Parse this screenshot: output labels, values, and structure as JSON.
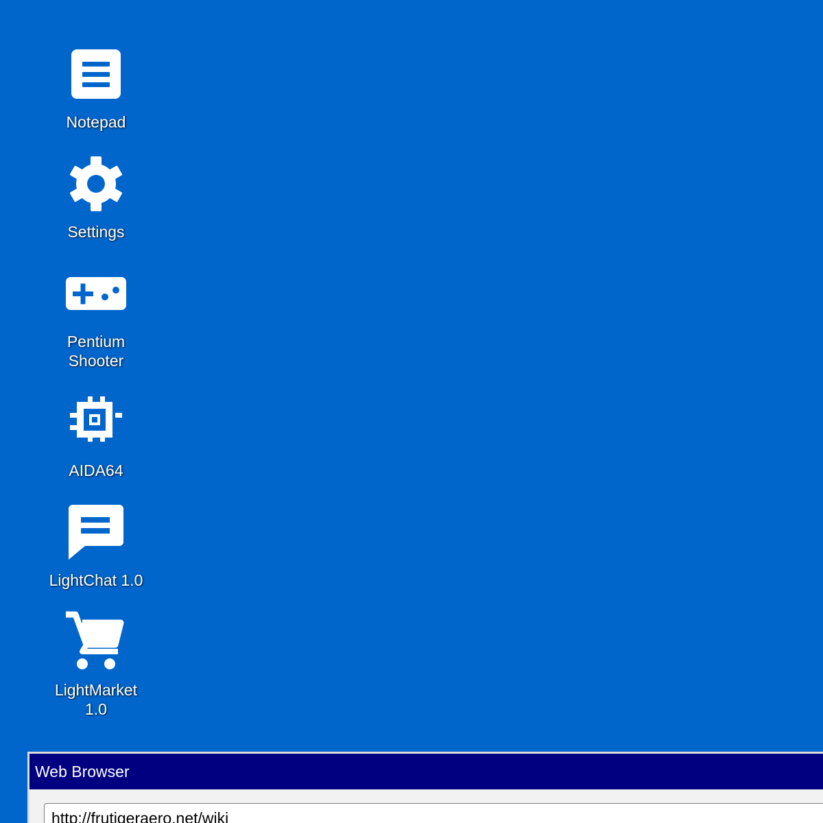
{
  "desktop": {
    "background_color": "#0066cc",
    "icons": [
      {
        "label": "Notepad",
        "icon": "notepad-icon"
      },
      {
        "label": "Settings",
        "icon": "gear-icon"
      },
      {
        "label": "Pentium\nShooter",
        "icon": "gamepad-icon"
      },
      {
        "label": "AIDA64",
        "icon": "chip-icon"
      },
      {
        "label": "LightChat 1.0",
        "icon": "chat-bubble-icon"
      },
      {
        "label": "LightMarket\n1.0",
        "icon": "shopping-cart-icon"
      }
    ]
  },
  "browser_window": {
    "title": "Web Browser",
    "title_bar_color": "#000080",
    "url": "http://frutigeraero.net/wiki"
  }
}
